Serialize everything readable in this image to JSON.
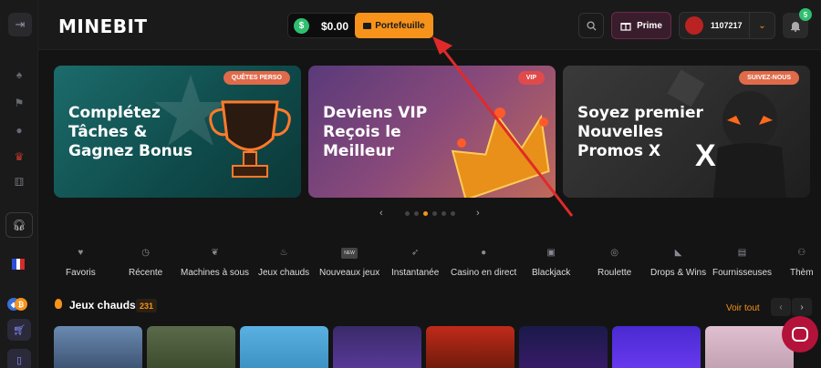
{
  "header": {
    "logo": "MINEBIT",
    "balance": "$0.00",
    "wallet_label": "Portefeuille",
    "prime_label": "Prime",
    "user_id": "1107217",
    "notification_count": "5"
  },
  "banners": [
    {
      "tag": "QUÊTES PERSO",
      "lines": [
        "Complétez",
        "Tâches &",
        "Gagnez Bonus"
      ]
    },
    {
      "tag": "VIP",
      "lines": [
        "Deviens VIP",
        "Reçois le",
        "Meilleur"
      ]
    },
    {
      "tag": "SUIVEZ-NOUS",
      "lines": [
        "Soyez premier",
        "Nouvelles",
        "Promos X"
      ]
    }
  ],
  "categories": [
    {
      "label": "Favoris",
      "icon": "heart-icon"
    },
    {
      "label": "Récente",
      "icon": "clock-icon"
    },
    {
      "label": "Machines à sous",
      "icon": "cherry-icon"
    },
    {
      "label": "Jeux chauds",
      "icon": "flame-icon"
    },
    {
      "label": "Nouveaux jeux",
      "icon": "new-badge-icon",
      "badge": "NEW"
    },
    {
      "label": "Instantanée",
      "icon": "rocket-icon"
    },
    {
      "label": "Casino en direct",
      "icon": "live-user-icon"
    },
    {
      "label": "Blackjack",
      "icon": "cards-icon"
    },
    {
      "label": "Roulette",
      "icon": "roulette-icon"
    },
    {
      "label": "Drops & Wins",
      "icon": "megaphone-icon"
    },
    {
      "label": "Fournisseuses",
      "icon": "provider-icon"
    },
    {
      "label": "Thèm",
      "icon": "theme-icon"
    }
  ],
  "section": {
    "title": "Jeux chauds",
    "count": "231",
    "see_all": "Voir tout"
  },
  "colors": {
    "accent": "#f7931a",
    "prime": "#b3133a",
    "success": "#2fbf6e"
  }
}
